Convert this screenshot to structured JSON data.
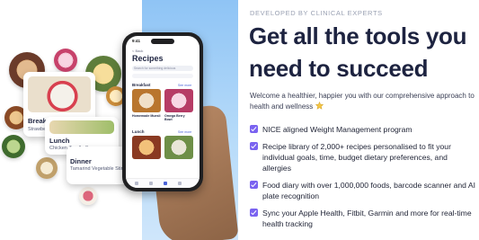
{
  "illustration": {
    "meal_cards": [
      {
        "title": "Breakfast",
        "subtitle": "Strawberry Overnight Oats (v)"
      },
      {
        "title": "Lunch",
        "subtitle": "Chicken Zoodle Soup"
      },
      {
        "title": "Dinner",
        "subtitle": "Tamarind Vegetable Stir Fry (v)"
      }
    ],
    "phone": {
      "time": "9:41",
      "back": "< Back",
      "title": "Recipes",
      "search_placeholder": "Search for something delicious",
      "sections": [
        {
          "label": "Breakfast",
          "see_more": "See more",
          "items": [
            "Homemade Muesli",
            "Omega Berry Bowl"
          ]
        },
        {
          "label": "Lunch",
          "see_more": "See more",
          "items": [
            "",
            ""
          ]
        }
      ]
    }
  },
  "content": {
    "eyebrow": "DEVELOPED BY CLINICAL EXPERTS",
    "headline": "Get all the tools you need to succeed",
    "intro": "Welcome a healthier, happier you with our comprehensive approach to health and wellness",
    "features": [
      "NICE aligned Weight Management program",
      "Recipe library of 2,000+ recipes personalised to fit your individual goals, time, budget dietary preferences, and allergies",
      "Food diary with over 1,000,000 foods, barcode scanner and AI plate recognition",
      "Sync your Apple Health, Fitbit, Garmin and more for real-time health tracking"
    ]
  },
  "colors": {
    "headline": "#1d2340",
    "accent": "#7a63f0",
    "sky": "#8fc4f5",
    "star": "#f5c542"
  }
}
